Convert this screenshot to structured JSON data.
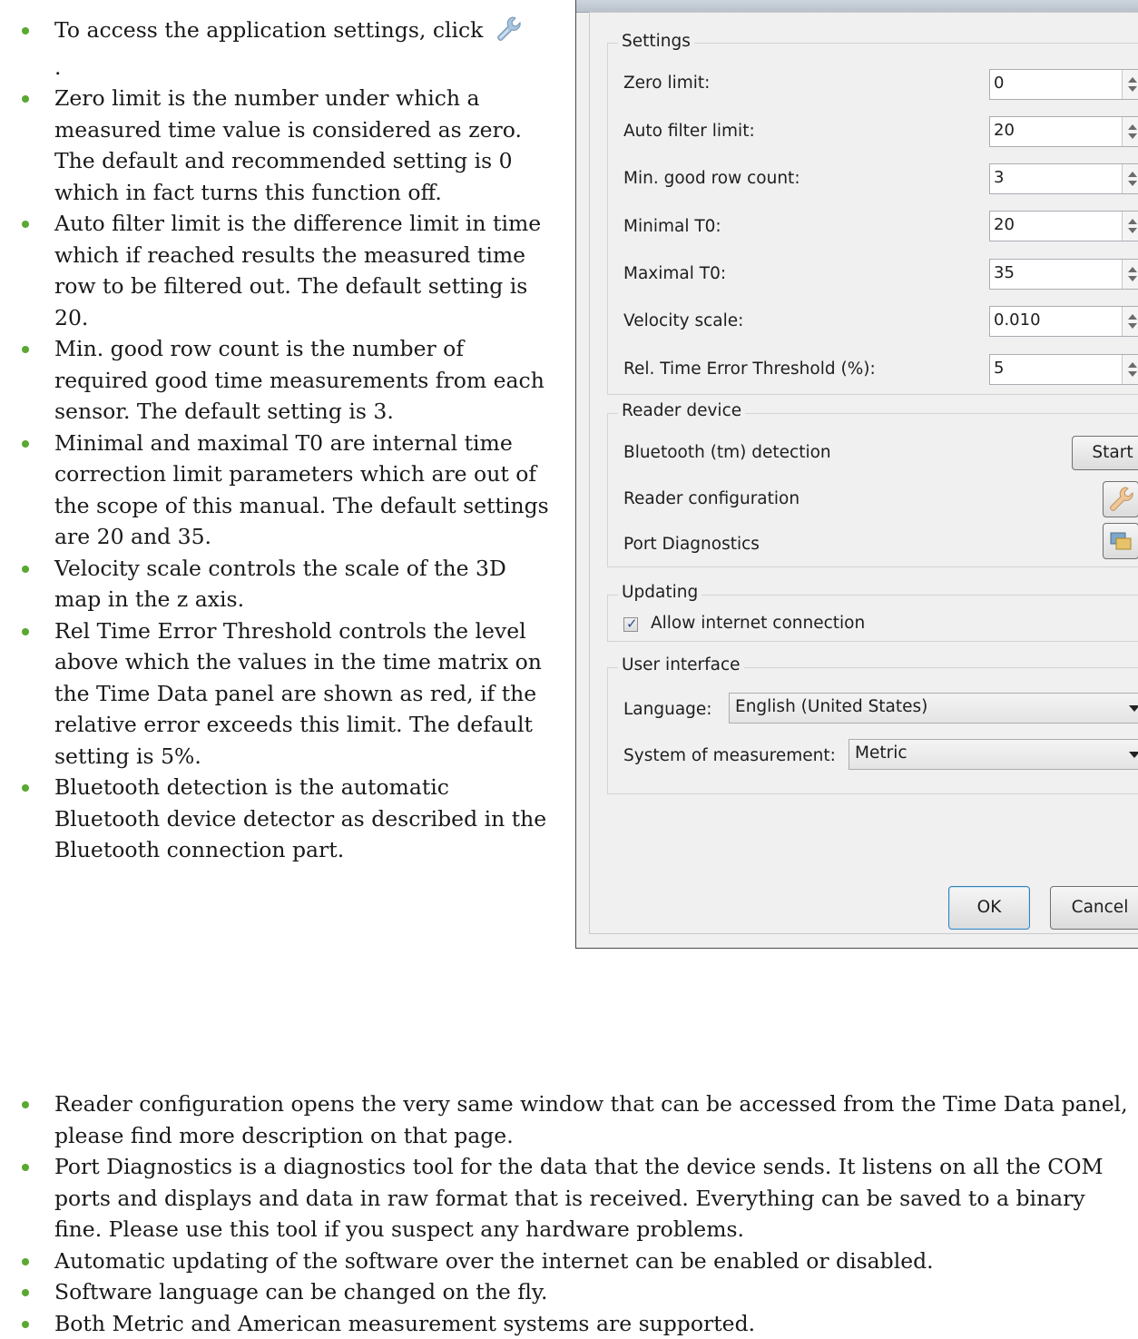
{
  "left_bullets": [
    {
      "text": "To access the application settings, click",
      "icon": "wrench-icon",
      "after": "."
    },
    {
      "text": "Zero limit is the number under which a measured time value is considered as zero. The default and recommended setting is 0 which in fact turns this function off."
    },
    {
      "text": "Auto filter limit is the difference limit in time which if reached results the measured time row to be filtered out. The default setting is 20."
    },
    {
      "text": "Min. good row count is the number of required good time measurements from each sensor. The default setting is 3."
    },
    {
      "text": "Minimal and maximal T0 are internal time correction limit parameters which are out of the scope of this manual. The default settings are 20 and 35."
    },
    {
      "text": "Velocity scale controls the scale of the 3D map in the z axis."
    },
    {
      "text": "Rel Time Error Threshold controls the level above which the values in the time matrix on the Time Data panel are shown as red, if the relative error exceeds this limit. The default setting is 5%."
    },
    {
      "text": "Bluetooth detection is the automatic Bluetooth device detector as described in the Bluetooth connection part."
    }
  ],
  "bottom_bullets": [
    {
      "text": "Reader configuration opens the very same window that can be accessed from the Time Data panel, please find more description on that page."
    },
    {
      "text": "Port Diagnostics is a diagnostics tool for the data that the device sends. It listens on all the COM ports and displays and data in raw format that is received. Everything can be saved to a binary fine. Please use this tool if you suspect any hardware problems."
    },
    {
      "text": "Automatic updating of the software over the internet can be enabled or disabled."
    },
    {
      "text": "Software language can be changed on the fly."
    },
    {
      "text": "Both Metric and American measurement systems are supported."
    }
  ],
  "dialog": {
    "settings_group": {
      "title": "Settings",
      "fields": [
        {
          "label": "Zero limit:",
          "value": "0"
        },
        {
          "label": "Auto filter limit:",
          "value": "20"
        },
        {
          "label": "Min. good row count:",
          "value": "3"
        },
        {
          "label": "Minimal T0:",
          "value": "20"
        },
        {
          "label": "Maximal T0:",
          "value": "35"
        },
        {
          "label": "Velocity scale:",
          "value": "0.010"
        },
        {
          "label": "Rel. Time Error Threshold (%):",
          "value": "5"
        }
      ]
    },
    "reader_group": {
      "title": "Reader device",
      "bluetooth_label": "Bluetooth (tm) detection",
      "start_button": "Start",
      "reader_config_label": "Reader configuration",
      "port_diag_label": "Port Diagnostics"
    },
    "updating_group": {
      "title": "Updating",
      "checkbox_label": "Allow internet connection",
      "checked": true
    },
    "ui_group": {
      "title": "User interface",
      "language_label": "Language:",
      "language_value": "English (United States)",
      "measurement_label": "System of measurement:",
      "measurement_value": "Metric"
    },
    "ok_button": "OK",
    "cancel_button": "Cancel"
  },
  "colors": {
    "bullet": "#5aa832",
    "ok_border": "#3c7fb1"
  }
}
